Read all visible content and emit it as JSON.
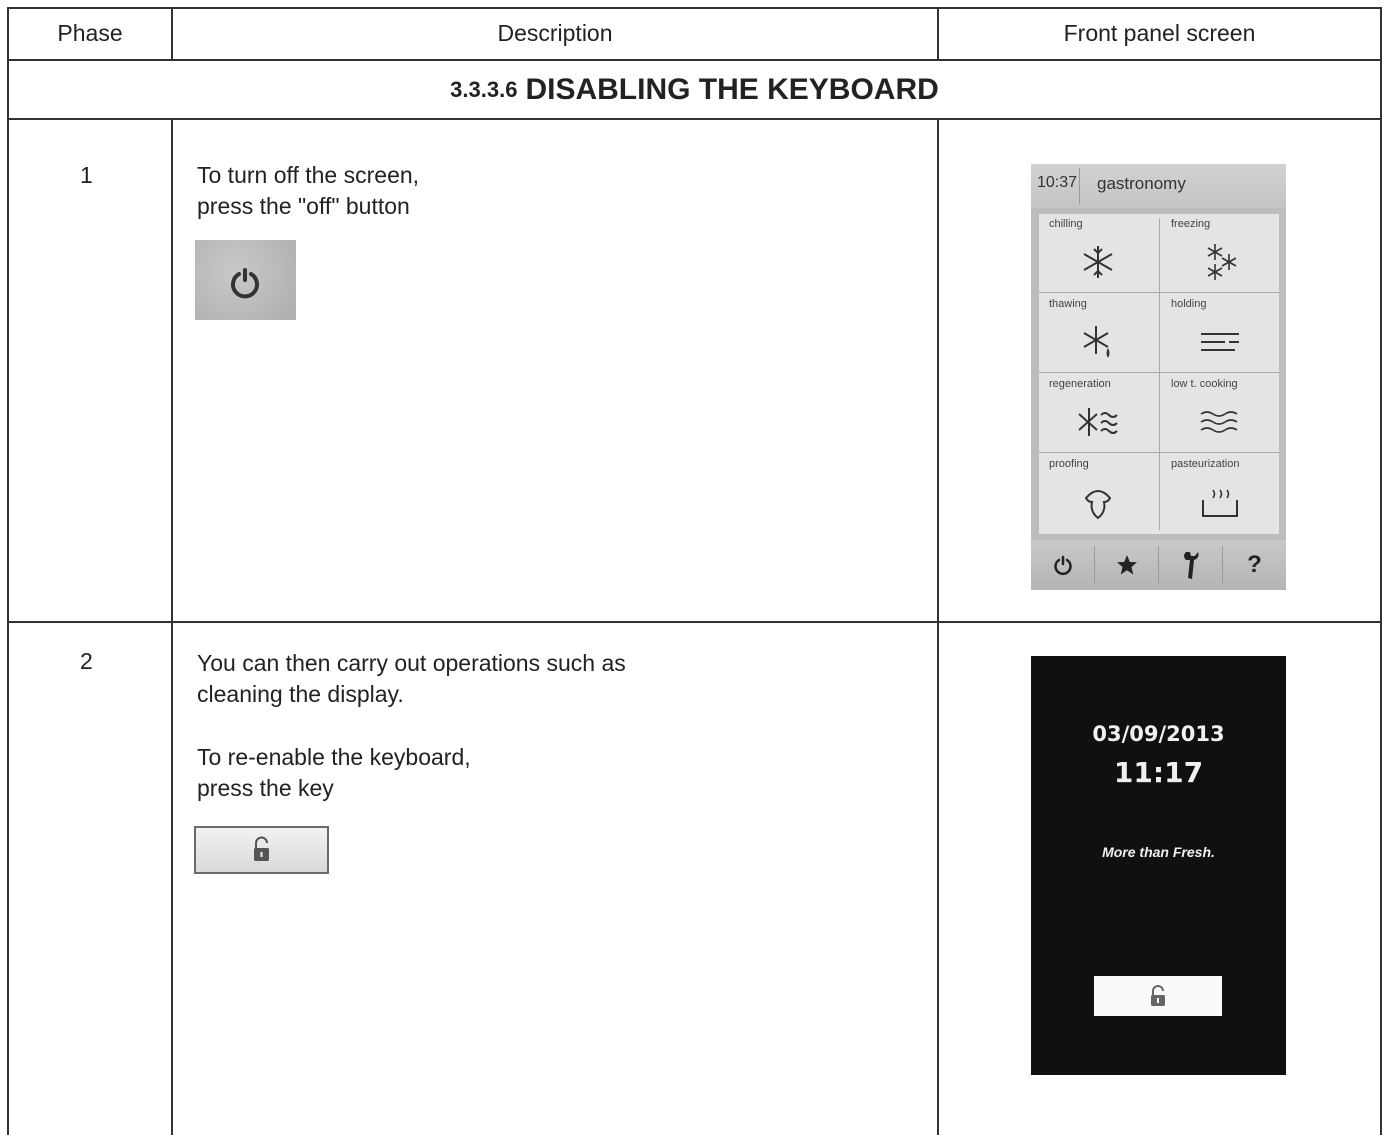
{
  "table": {
    "headers": {
      "phase": "Phase",
      "description": "Description",
      "screen": "Front panel screen"
    },
    "section": {
      "number": "3.3.3.6",
      "title": "DISABLING THE KEYBOARD"
    },
    "rows": [
      {
        "phase": "1",
        "lines": [
          "To turn off the screen,",
          "press the \"off\" button"
        ]
      },
      {
        "phase": "2",
        "lines": [
          "You can then carry out operations such as",
          "cleaning the display.",
          "To re-enable the keyboard,",
          "press the key"
        ]
      }
    ]
  },
  "panel_menu": {
    "time": "10:37",
    "mode": "gastronomy",
    "cells": [
      "chilling",
      "freezing",
      "thawing",
      "holding",
      "regeneration",
      "low t. cooking",
      "proofing",
      "pasteurization"
    ],
    "bottom": [
      "power-icon",
      "star-icon",
      "wrench-icon",
      "help-icon"
    ],
    "help_glyph": "?"
  },
  "panel_standby": {
    "date": "03/09/2013",
    "time": "11:17",
    "slogan": "More than Fresh."
  },
  "colors": {
    "rule": "#333333",
    "panel_bg": "#bdbdbb",
    "standby_bg": "#101010"
  }
}
